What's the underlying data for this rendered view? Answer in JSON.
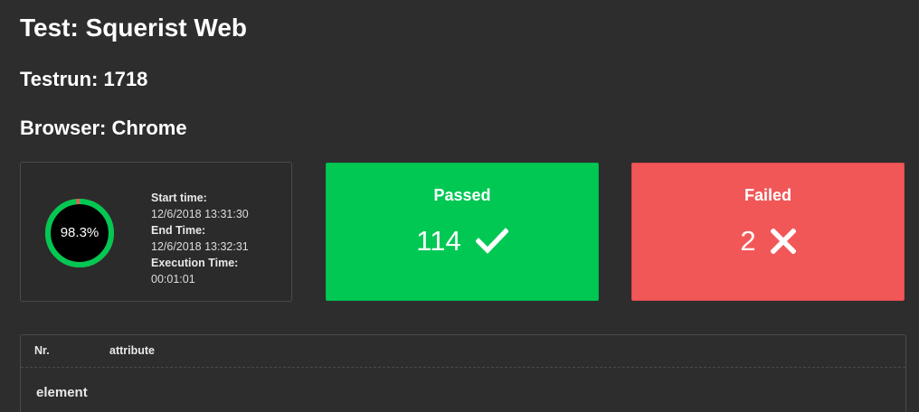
{
  "header": {
    "test_title": "Test: Squerist Web",
    "testrun": "Testrun: 1718",
    "browser": "Browser: Chrome"
  },
  "summary": {
    "pass_rate": 98.3,
    "pass_rate_label": "98.3%",
    "start_label": "Start time:",
    "start_value": "12/6/2018 13:31:30",
    "end_label": "End Time:",
    "end_value": "12/6/2018 13:32:31",
    "exec_label": "Execution Time:",
    "exec_value": "00:01:01",
    "ring_color": "#00c853",
    "remainder_color": "#f25757"
  },
  "stats": {
    "passed": {
      "title": "Passed",
      "value": "114",
      "icon": "check-icon",
      "color": "#00c853"
    },
    "failed": {
      "title": "Failed",
      "value": "2",
      "icon": "x-icon",
      "color": "#f25757"
    }
  },
  "table": {
    "headers": [
      "Nr.",
      "attribute"
    ],
    "rows": [
      "element"
    ]
  }
}
